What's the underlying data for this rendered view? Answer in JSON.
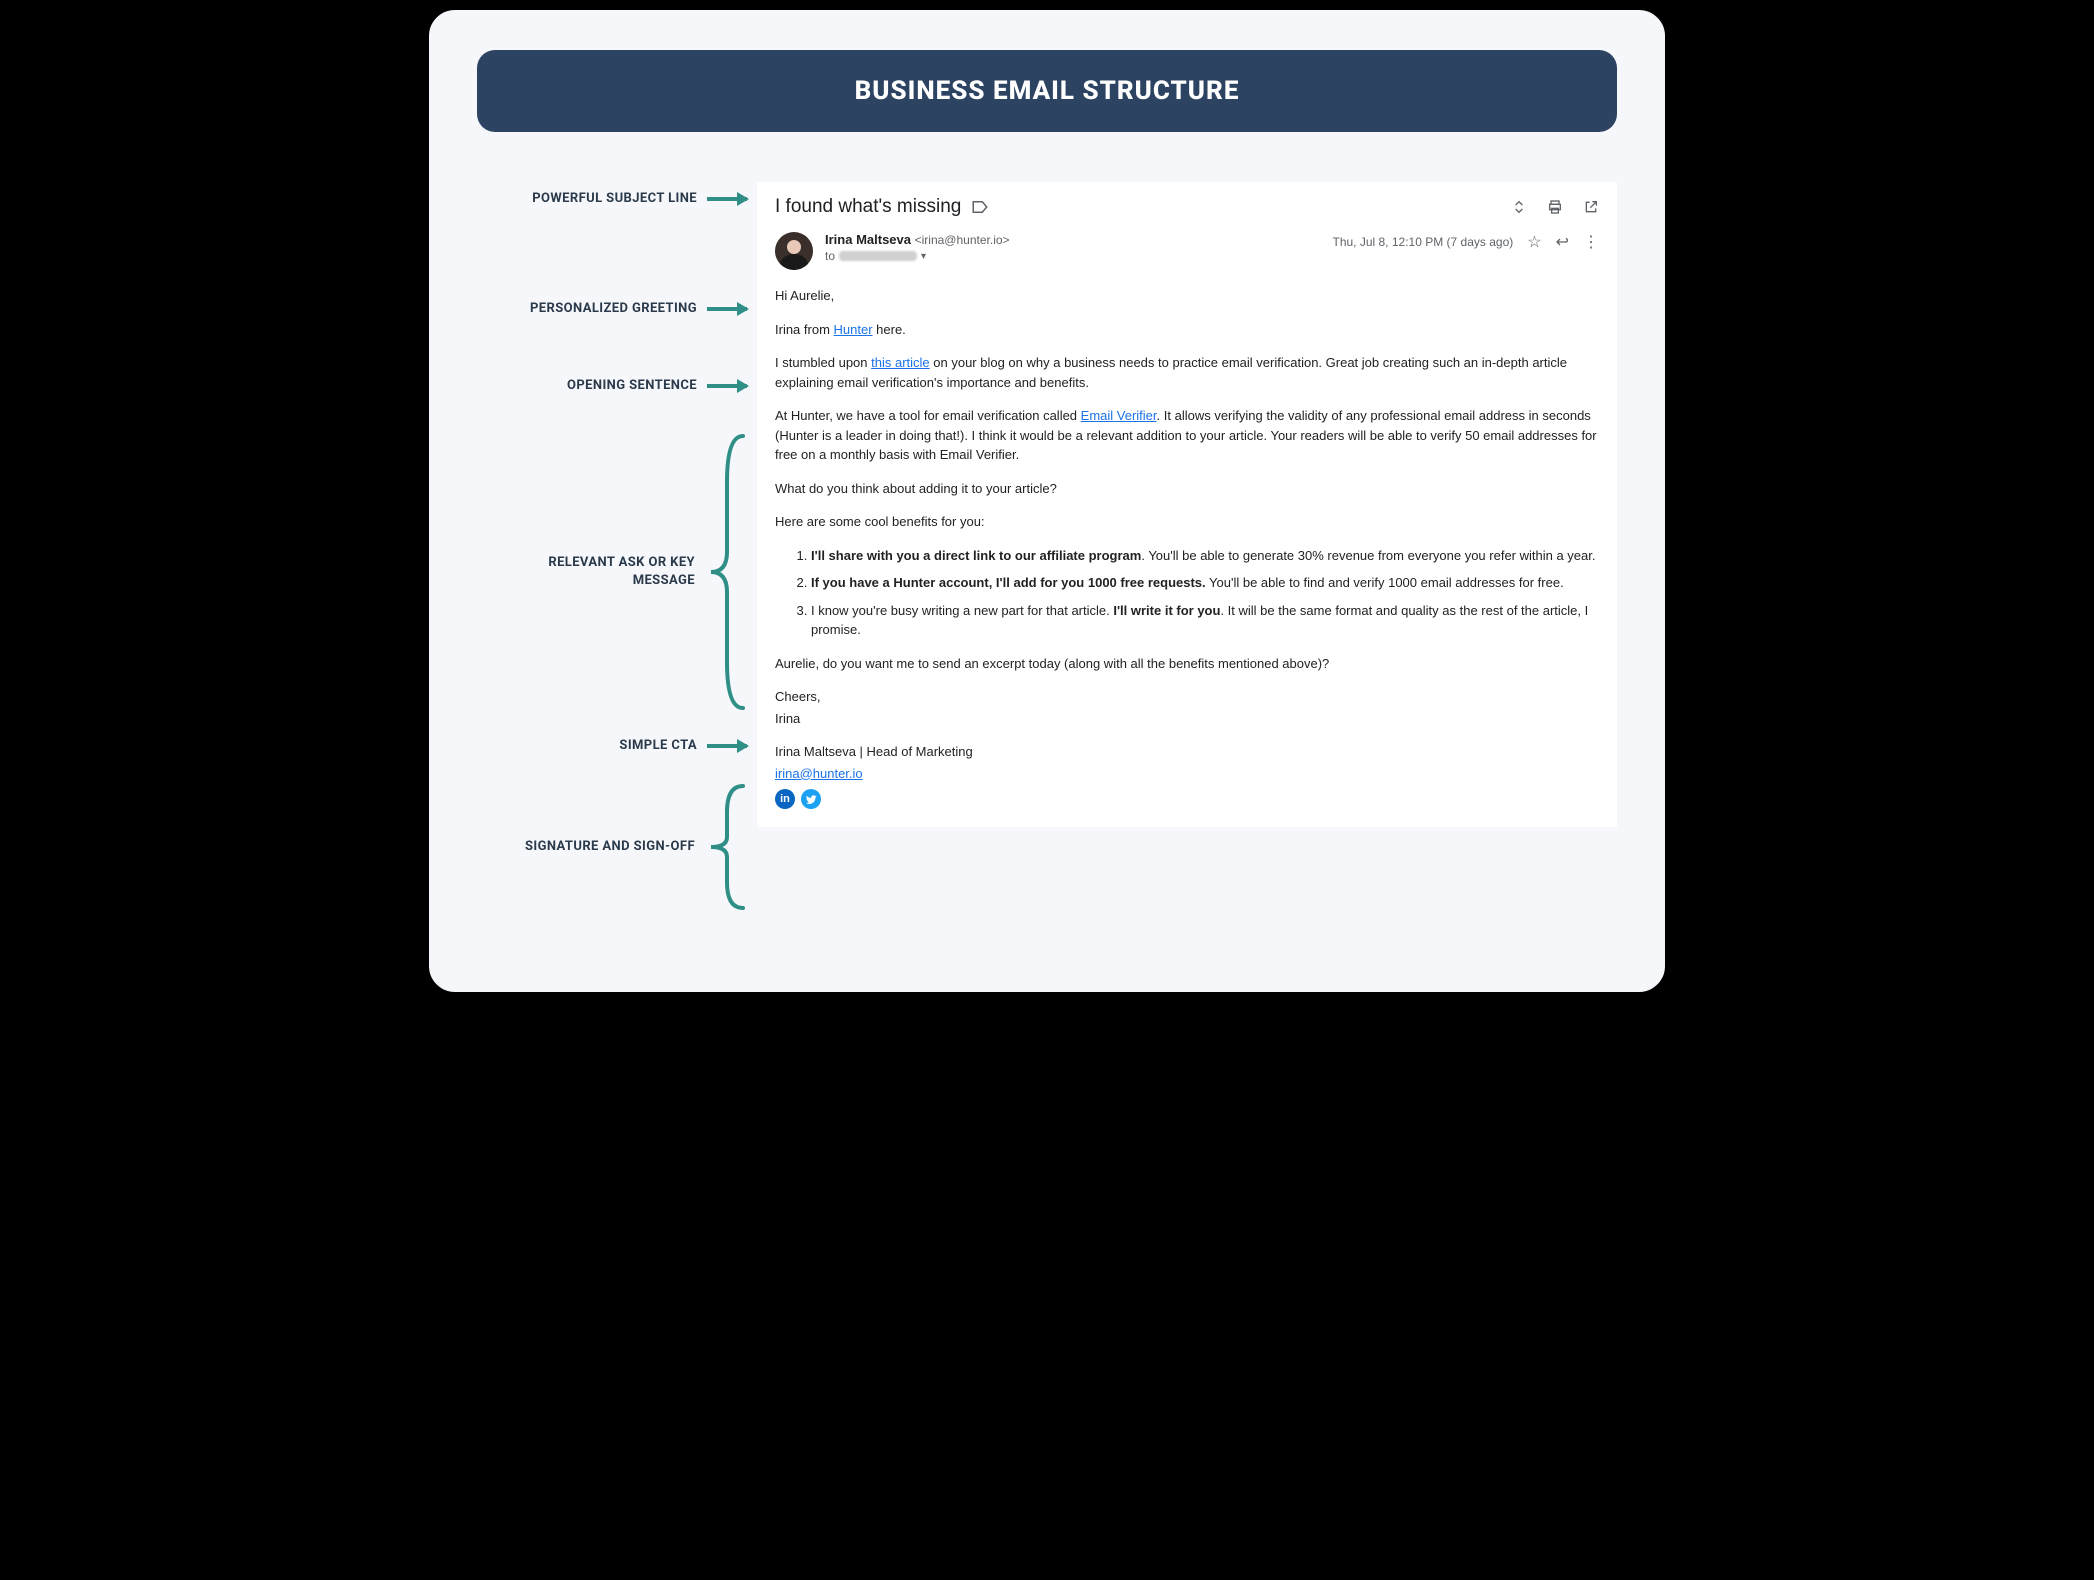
{
  "title": "BUSINESS EMAIL STRUCTURE",
  "labels": {
    "subject": "POWERFUL SUBJECT LINE",
    "greeting": "PERSONALIZED GREETING",
    "opening": "OPENING SENTENCE",
    "ask": "RELEVANT ASK OR KEY MESSAGE",
    "cta": "SIMPLE CTA",
    "signoff": "SIGNATURE AND SIGN-OFF"
  },
  "email": {
    "subject": "I found what's missing",
    "from_name": "Irina Maltseva",
    "from_addr": "<irina@hunter.io>",
    "to_prefix": "to",
    "date": "Thu, Jul 8, 12:10 PM (7 days ago)",
    "greeting": "Hi Aurelie,",
    "intro": "Irina from ",
    "intro_link": "Hunter",
    "intro_after": " here.",
    "opening_before": "I stumbled upon ",
    "opening_link": "this article",
    "opening_after": " on your blog on why a business needs to practice email verification. Great job creating such an in-depth article explaining email verification's importance and benefits.",
    "ask_p1_before": "At Hunter, we have a tool for email verification called ",
    "ask_p1_link": "Email Verifier",
    "ask_p1_after": ". It allows verifying the validity of any professional email address in seconds (Hunter is a leader in doing that!). I think it would be a relevant addition to your article. Your readers will be able to verify 50 email addresses for free on a monthly basis with Email Verifier.",
    "ask_p2": "What do you think about adding it to your article?",
    "ask_p3": "Here are some cool benefits for you:",
    "benefits": {
      "b1_bold": "I'll share with you a direct link to our affiliate program",
      "b1_rest": ". You'll be able to generate 30% revenue from everyone you refer within a year.",
      "b2_bold": "If you have a Hunter account, I'll add for you 1000 free requests.",
      "b2_rest": " You'll be able to find and verify 1000 email addresses for free.",
      "b3_before": "I know you're busy writing a new part for that article. ",
      "b3_bold": "I'll write it for you",
      "b3_after": ". It will be the same format and quality as the rest of the article, I promise."
    },
    "cta": "Aurelie, do you want me to send an excerpt today (along with all the benefits mentioned above)?",
    "sig_cheers": "Cheers,",
    "sig_name": "Irina",
    "sig_full": "Irina Maltseva | Head of Marketing",
    "sig_email": "irina@hunter.io"
  }
}
